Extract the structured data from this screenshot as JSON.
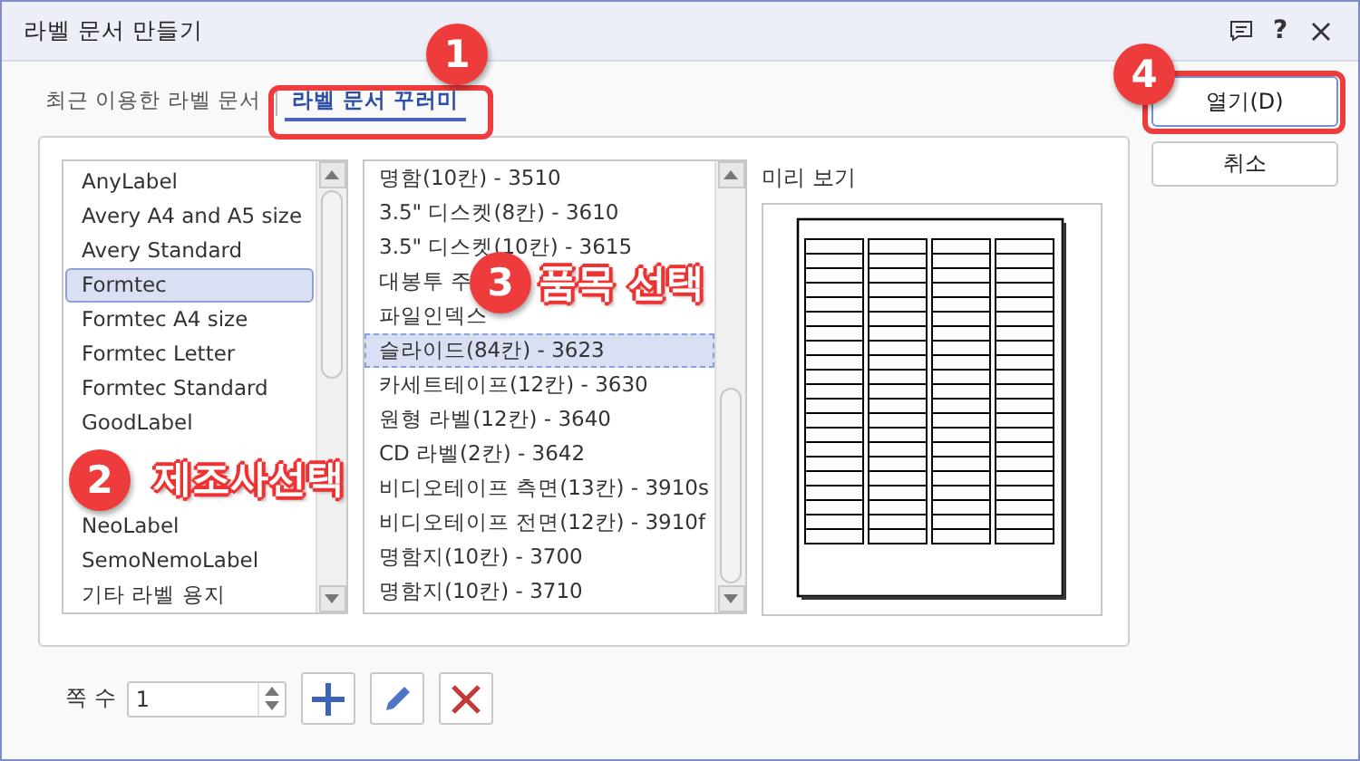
{
  "window": {
    "title": "라벨 문서 만들기",
    "help_label": "?"
  },
  "tabs": [
    {
      "label": "최근 이용한 라벨 문서",
      "selected": false
    },
    {
      "label": "라벨 문서 꾸러미",
      "selected": true
    }
  ],
  "manufacturers": [
    {
      "kind": "text",
      "label": "AnyLabel",
      "selected": false
    },
    {
      "kind": "text",
      "label": "Avery A4 and A5 size",
      "selected": false
    },
    {
      "kind": "text",
      "label": "Avery Standard",
      "selected": false
    },
    {
      "kind": "text",
      "label": "Formtec",
      "selected": true
    },
    {
      "kind": "text",
      "label": "Formtec A4 size",
      "selected": false
    },
    {
      "kind": "text",
      "label": "Formtec Letter",
      "selected": false
    },
    {
      "kind": "text",
      "label": "Formtec Standard",
      "selected": false
    },
    {
      "kind": "text",
      "label": "GoodLabel",
      "selected": false
    },
    {
      "kind": "covered",
      "selected": false
    },
    {
      "kind": "covered",
      "selected": false
    },
    {
      "kind": "text",
      "label": "NeoLabel",
      "selected": false
    },
    {
      "kind": "text",
      "label": "SemoNemoLabel",
      "selected": false
    },
    {
      "kind": "text",
      "label": "기타 라벨 용지",
      "selected": false
    }
  ],
  "products": [
    {
      "kind": "text",
      "label": "명함(10칸) - 3510",
      "selected": false
    },
    {
      "kind": "text",
      "label": "3.5\" 디스켓(8칸) - 3610",
      "selected": false
    },
    {
      "kind": "text",
      "label": "3.5\" 디스켓(10칸) - 3615",
      "selected": false
    },
    {
      "kind": "text",
      "label": "대봉투 주",
      "selected": false
    },
    {
      "kind": "text",
      "label": "파일인덱스",
      "selected": false
    },
    {
      "kind": "text",
      "label": "슬라이드(84칸) - 3623",
      "selected": true
    },
    {
      "kind": "text",
      "label": "카세트테이프(12칸) - 3630",
      "selected": false
    },
    {
      "kind": "text",
      "label": "원형 라벨(12칸) - 3640",
      "selected": false
    },
    {
      "kind": "text",
      "label": "CD 라벨(2칸) - 3642",
      "selected": false
    },
    {
      "kind": "text",
      "label": "비디오테이프 측면(13칸) - 3910s",
      "selected": false
    },
    {
      "kind": "text",
      "label": "비디오테이프 전면(12칸) - 3910f",
      "selected": false
    },
    {
      "kind": "text",
      "label": "명함지(10칸) - 3700",
      "selected": false
    },
    {
      "kind": "text",
      "label": "명함지(10칸) - 3710",
      "selected": false
    }
  ],
  "preview": {
    "label": "미리 보기"
  },
  "buttons": [
    {
      "label": "열기(D)",
      "kind": "primary"
    },
    {
      "label": "취소",
      "kind": "normal"
    }
  ],
  "pages": {
    "label": "쪽 수",
    "value": "1"
  },
  "callouts": [
    {
      "number": "1",
      "kind": "frame"
    },
    {
      "number": "2",
      "caption": "제조사선택",
      "kind": "caption"
    },
    {
      "number": "3",
      "caption": "품목 선택",
      "kind": "caption"
    },
    {
      "number": "4",
      "kind": "frame"
    }
  ]
}
